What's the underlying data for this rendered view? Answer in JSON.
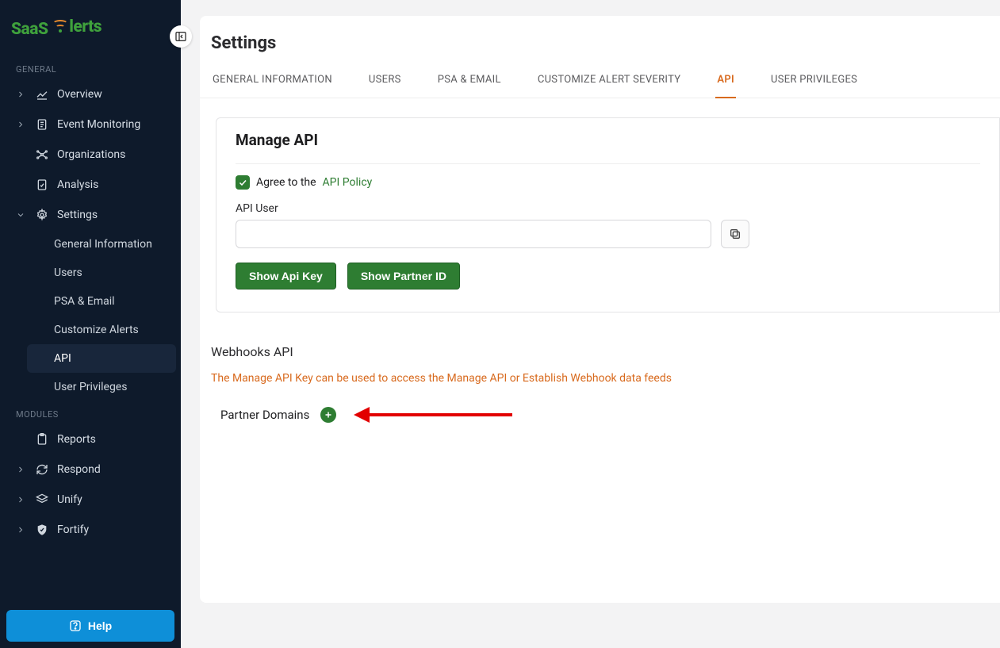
{
  "brand": {
    "name": "SaaS Alerts"
  },
  "sidebar": {
    "sections": {
      "general_label": "GENERAL",
      "modules_label": "MODULES"
    },
    "items": {
      "overview": "Overview",
      "event_monitoring": "Event Monitoring",
      "organizations": "Organizations",
      "analysis": "Analysis",
      "settings": "Settings",
      "reports": "Reports",
      "respond": "Respond",
      "unify": "Unify",
      "fortify": "Fortify"
    },
    "settings_children": {
      "general_information": "General Information",
      "users": "Users",
      "psa_email": "PSA & Email",
      "customize_alerts": "Customize Alerts",
      "api": "API",
      "user_privileges": "User Privileges"
    },
    "help": "Help"
  },
  "page": {
    "title": "Settings",
    "tabs": {
      "general_information": "GENERAL INFORMATION",
      "users": "USERS",
      "psa_email": "PSA & EMAIL",
      "customize_alert_severity": "CUSTOMIZE ALERT SEVERITY",
      "api": "API",
      "user_privileges": "USER PRIVILEGES"
    },
    "manage_api": {
      "heading": "Manage API",
      "agree_prefix": "Agree to the ",
      "agree_link": "API Policy",
      "api_user_label": "API User",
      "api_user_value": "",
      "show_api_key_btn": "Show Api Key",
      "show_partner_id_btn": "Show Partner ID"
    },
    "webhooks_heading": "Webhooks API",
    "webhooks_notice": "The Manage API Key can be used to access the Manage API or Establish Webhook data feeds",
    "partner_domains_label": "Partner Domains"
  }
}
